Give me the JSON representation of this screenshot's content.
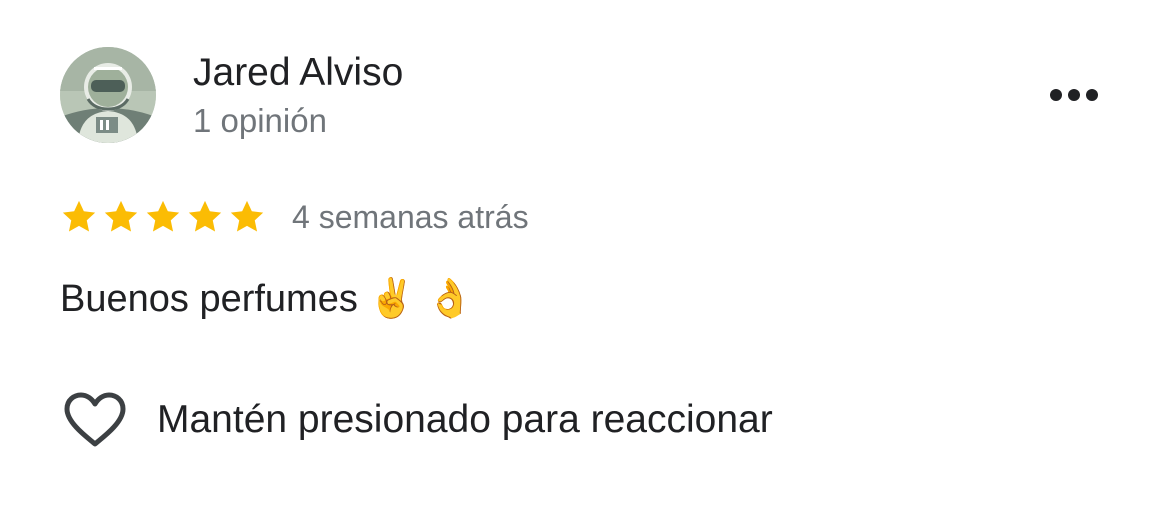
{
  "review": {
    "author_name": "Jared Alviso",
    "review_count": "1 opinión",
    "avatar_icon": "astronaut-avatar-icon",
    "rating": 5,
    "rating_max": 5,
    "star_color": "#fbbc04",
    "date": "4 semanas atrás",
    "text": "Buenos perfumes ✌️ 👌",
    "more_icon": "more-horizontal-icon"
  },
  "actions": {
    "react_icon": "heart-outline-icon",
    "react_label": "Mantén presionado para reaccionar"
  }
}
